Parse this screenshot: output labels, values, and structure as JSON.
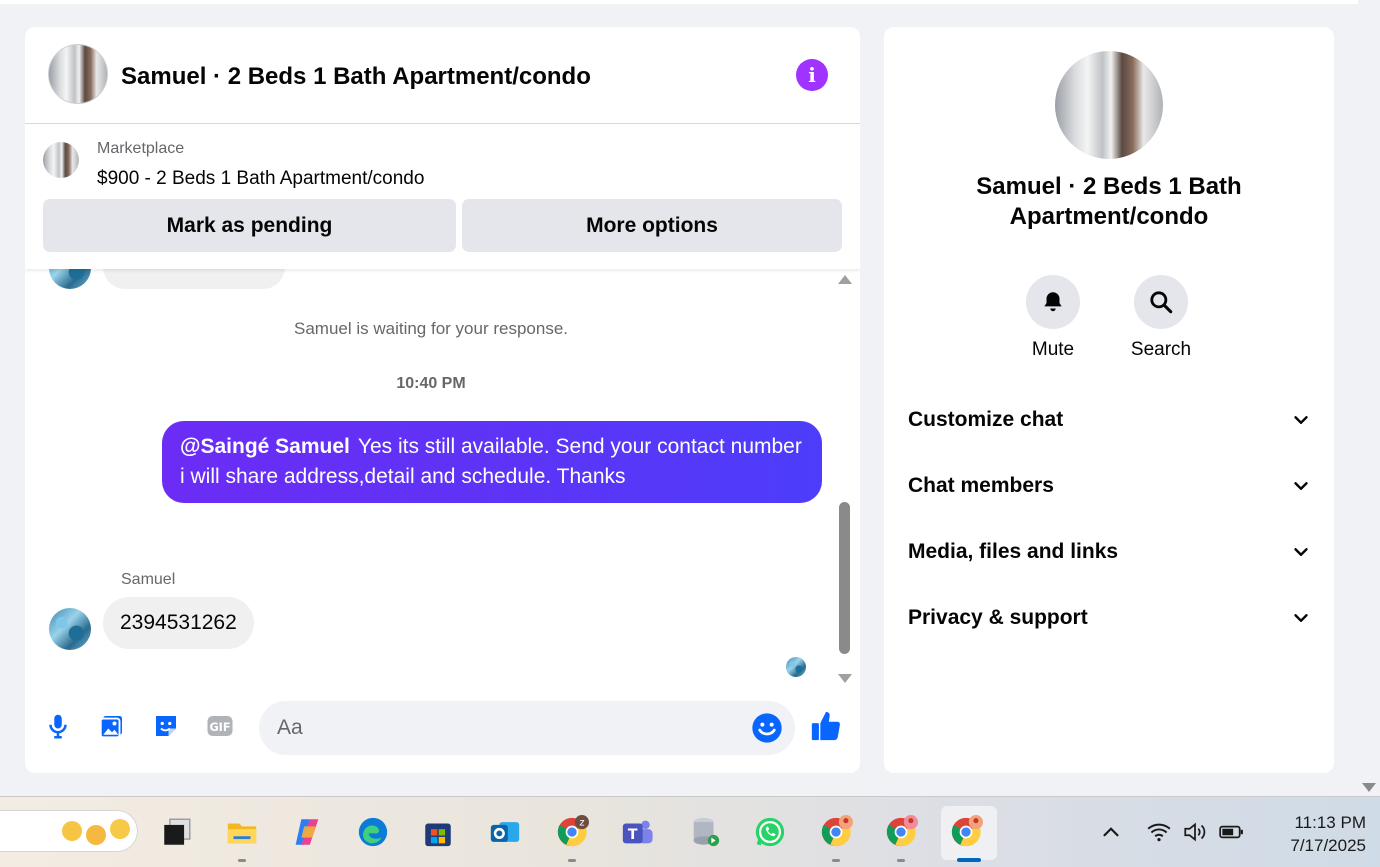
{
  "chat": {
    "title": "Samuel · 2 Beds 1 Bath Apartment/condo",
    "marketplace": {
      "label": "Marketplace",
      "listing": "$900 - 2 Beds 1 Bath Apartment/condo",
      "mark_pending": "Mark as pending",
      "more_options": "More options"
    },
    "messages": {
      "waiting_notice": "Samuel is waiting for your response.",
      "timestamp": "10:40 PM",
      "outgoing": {
        "mention": "@Saingé Samuel",
        "text": "Yes its still available. Send your contact number i will share address,detail and schedule. Thanks"
      },
      "incoming_sender": "Samuel",
      "incoming_text": "2394531262"
    },
    "composer": {
      "placeholder": "Aa",
      "icons": [
        "microphone-icon",
        "photo-icon",
        "sticker-icon",
        "gif-icon",
        "emoji-icon",
        "thumbs-up-icon"
      ]
    },
    "accent_color": "#0866ff",
    "bubble_gradient": [
      "#6c2cf5",
      "#4d3dfb"
    ]
  },
  "side_panel": {
    "title": "Samuel · 2 Beds 1 Bath Apartment/condo",
    "actions": [
      {
        "label": "Mute",
        "icon": "bell-icon"
      },
      {
        "label": "Search",
        "icon": "search-icon"
      }
    ],
    "sections": [
      {
        "label": "Customize chat"
      },
      {
        "label": "Chat members"
      },
      {
        "label": "Media, files and links"
      },
      {
        "label": "Privacy & support"
      }
    ]
  },
  "taskbar": {
    "apps": [
      "task-view-icon",
      "file-explorer-icon",
      "copilot-icon",
      "edge-icon",
      "microsoft-store-icon",
      "outlook-icon",
      "chrome-icon",
      "teams-icon",
      "database-icon",
      "whatsapp-icon",
      "chrome-icon",
      "chrome-icon",
      "chrome-icon"
    ],
    "time": "11:13 PM",
    "date": "7/17/2025"
  }
}
